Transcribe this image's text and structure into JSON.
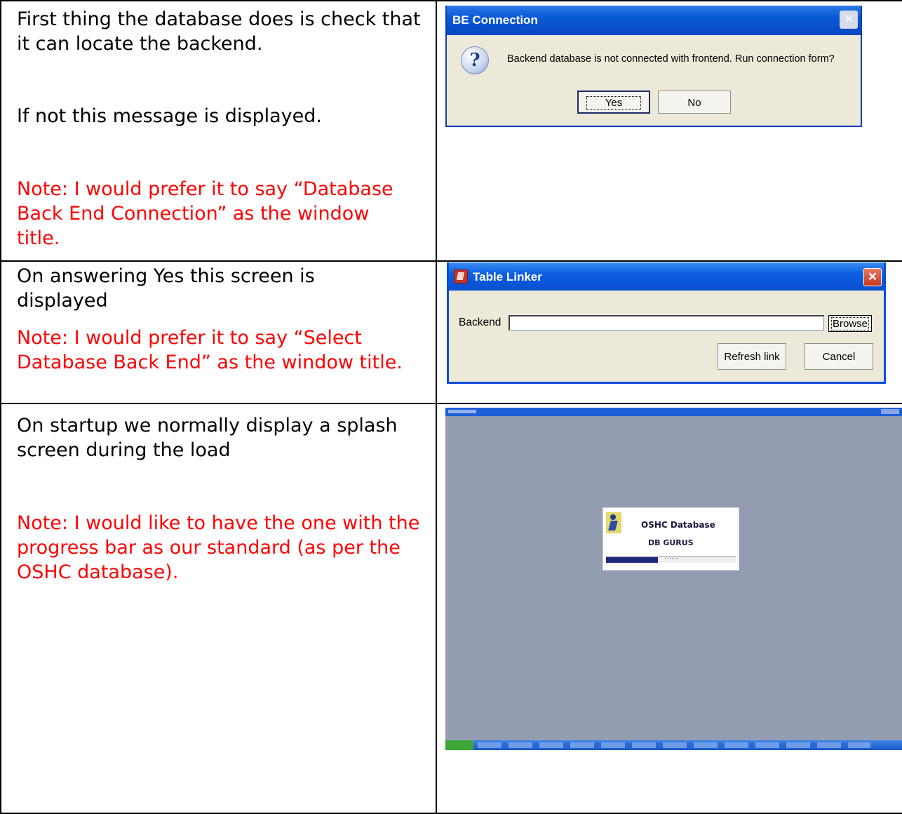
{
  "rows": [
    {
      "text1": "First thing the database does is check that it can locate the backend.",
      "text2": "If not this message is displayed.",
      "note": "Note: I would prefer it to say “Database Back End Connection” as the window title."
    },
    {
      "text1": "On answering Yes this screen is displayed",
      "note": "Note: I would prefer it to say “Select Database Back End” as the window title."
    },
    {
      "text1": "On startup we normally display a splash screen during the load",
      "note": "Note: I would like to have the one with the progress bar as our standard (as per the OSHC database)."
    }
  ],
  "be_dialog": {
    "title": "BE Connection",
    "message": "Backend database is not connected with frontend. Run connection form?",
    "yes_label": "Yes",
    "no_label": "No",
    "close_glyph": "✕",
    "icon": "question-icon"
  },
  "linker_dialog": {
    "title": "Table Linker",
    "backend_label": "Backend",
    "backend_value": "",
    "browse_label": "Browse",
    "refresh_label": "Refresh link",
    "cancel_label": "Cancel",
    "close_glyph": "✕",
    "icon": "access-app-icon"
  },
  "splash": {
    "app_name": "OSHC Database",
    "company": "DB GURUS",
    "progress": 0.4,
    "progress_dots": "......",
    "icon": "runner-logo-icon",
    "desktop_color": "#939db1",
    "titlebar_color": "#1f5fd6"
  }
}
